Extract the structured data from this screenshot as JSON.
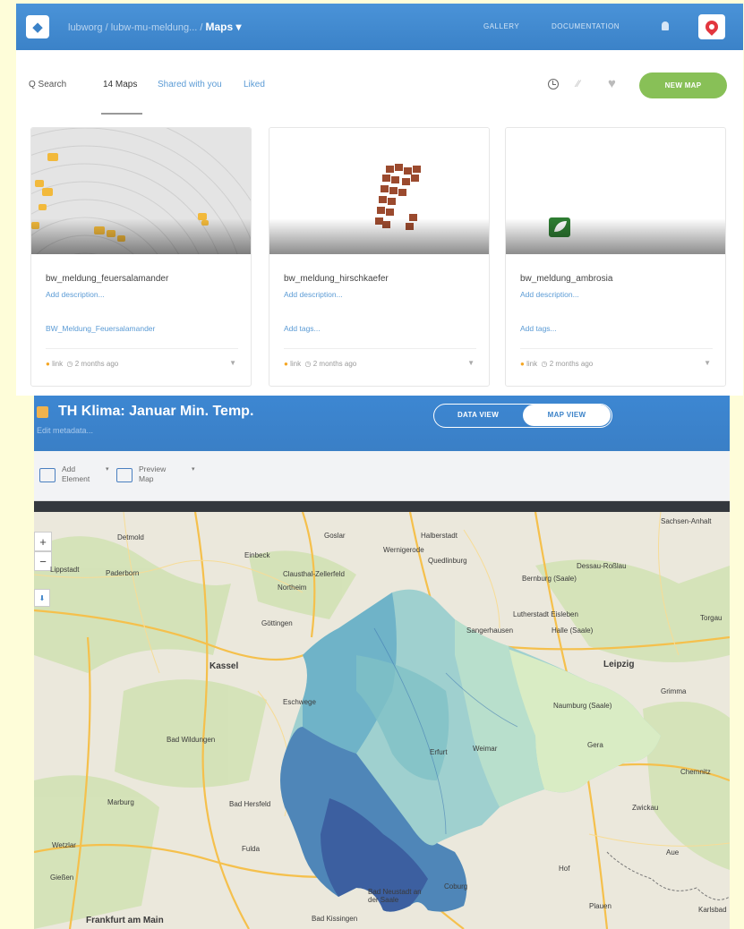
{
  "dashboard": {
    "breadcrumb": {
      "org": "lubworg",
      "dataset": "lubw-mu-meldung...",
      "sep": "/",
      "current": "Maps ▾"
    },
    "nav": {
      "gallery": "GALLERY",
      "documentation": "DOCUMENTATION"
    },
    "subnav": {
      "search": "Q Search",
      "maps_count": "14 Maps",
      "shared": "Shared with you",
      "liked": "Liked"
    },
    "new_map_label": "NEW MAP",
    "cards": [
      {
        "title": "bw_meldung_feuersalamander",
        "description": "Add description...",
        "tag": "BW_Meldung_Feuersalamander",
        "privacy": "link",
        "updated": "2 months ago"
      },
      {
        "title": "bw_meldung_hirschkaefer",
        "description": "Add description...",
        "tag": "Add tags...",
        "privacy": "link",
        "updated": "2 months ago"
      },
      {
        "title": "bw_meldung_ambrosia",
        "description": "Add description...",
        "tag": "Add tags...",
        "privacy": "link",
        "updated": "2 months ago"
      }
    ]
  },
  "editor": {
    "title": "TH Klima: Januar Min. Temp.",
    "meta": "Edit metadata...",
    "toggle": {
      "data_view": "DATA VIEW",
      "map_view": "MAP VIEW"
    },
    "toolbar": {
      "add_element": "Add Element",
      "preview_map": "Preview Map"
    },
    "zoom": {
      "in": "+",
      "out": "−"
    },
    "cities": [
      "Detmold",
      "Goslar",
      "Halberstadt",
      "Wernigerode",
      "Quedlinburg",
      "Paderborn",
      "Einbeck",
      "Clausthal-Zellerfeld",
      "Northeim",
      "Bernburg (Saale)",
      "Dessau-Roßlau",
      "Göttingen",
      "Lutherstadt Eisleben",
      "Halle (Saale)",
      "Sangerhausen",
      "Kassel",
      "Leipzig",
      "Naumburg (Saale)",
      "Bad Wildungen",
      "Eschwege",
      "Erfurt",
      "Weimar",
      "Gera",
      "Marburg",
      "Bad Hersfeld",
      "Fulda",
      "Zwickau",
      "Chemnitz",
      "Plauen",
      "Coburg",
      "Bad Kissingen",
      "Bad Neustadt an der Saale",
      "Frankfurt am Main",
      "Gießen",
      "Wetzlar",
      "Torgau",
      "Grimma",
      "Aue",
      "Hof",
      "Karlsbad",
      "Lippstadt",
      "Sachsen-Anhalt"
    ]
  },
  "colors": {
    "brand_blue": "#3b82c8",
    "new_map_green": "#88c057",
    "pin_red": "#e2363e",
    "choropleth_dark": "#2f4f9a",
    "choropleth_light": "#e8f3c8"
  }
}
